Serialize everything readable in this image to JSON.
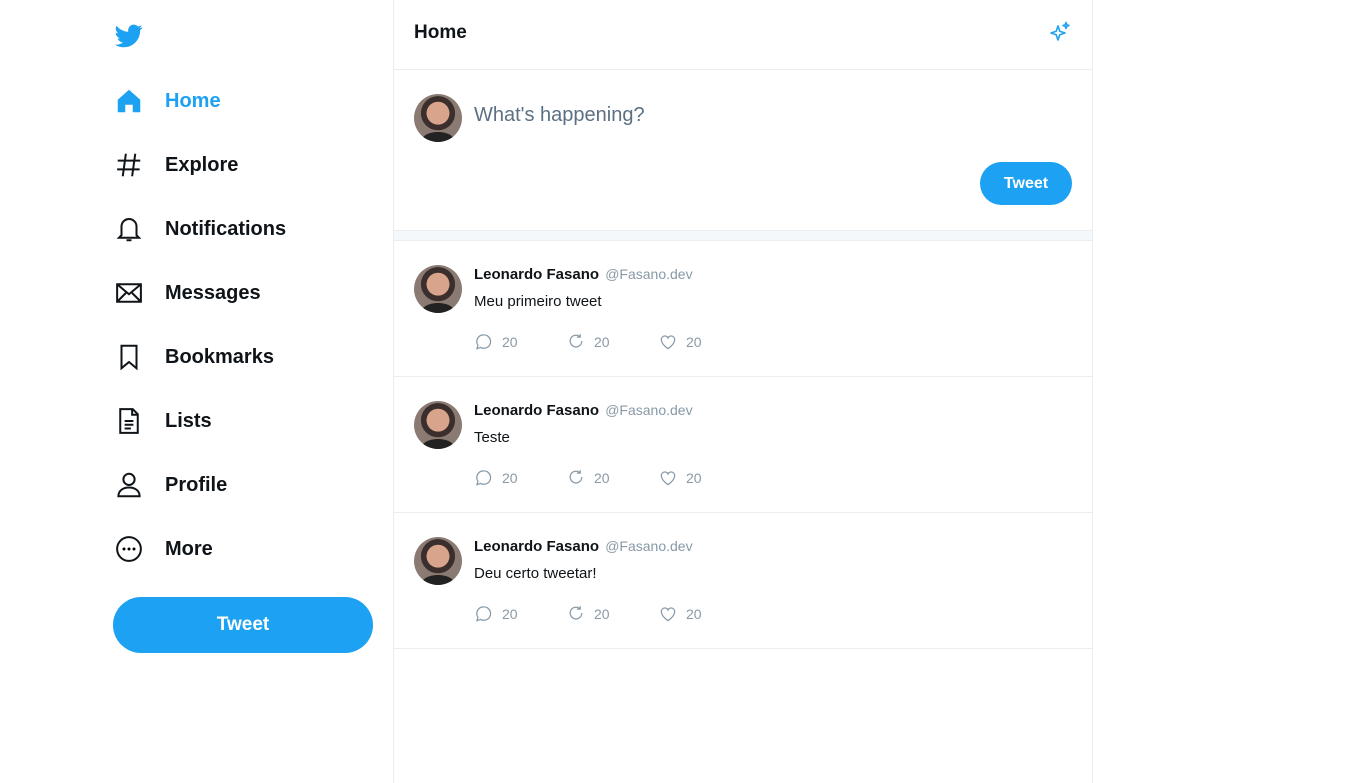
{
  "colors": {
    "accent": "#1da1f2",
    "muted": "#8899a6",
    "border": "#ebeef0"
  },
  "sidebar": {
    "logo": "twitter-bird-icon",
    "items": [
      {
        "label": "Home",
        "icon": "home-icon",
        "active": true
      },
      {
        "label": "Explore",
        "icon": "hashtag-icon"
      },
      {
        "label": "Notifications",
        "icon": "bell-icon"
      },
      {
        "label": "Messages",
        "icon": "envelope-icon"
      },
      {
        "label": "Bookmarks",
        "icon": "bookmark-icon"
      },
      {
        "label": "Lists",
        "icon": "list-icon"
      },
      {
        "label": "Profile",
        "icon": "user-icon"
      },
      {
        "label": "More",
        "icon": "more-icon"
      }
    ],
    "tweet_button": "Tweet"
  },
  "header": {
    "title": "Home",
    "icon": "sparkle-icon"
  },
  "composer": {
    "placeholder": "What's happening?",
    "button": "Tweet"
  },
  "tweets": [
    {
      "name": "Leonardo Fasano",
      "handle": "@Fasano.dev",
      "text": "Meu primeiro tweet",
      "replies": "20",
      "retweets": "20",
      "likes": "20"
    },
    {
      "name": "Leonardo Fasano",
      "handle": "@Fasano.dev",
      "text": "Teste",
      "replies": "20",
      "retweets": "20",
      "likes": "20"
    },
    {
      "name": "Leonardo Fasano",
      "handle": "@Fasano.dev",
      "text": "Deu certo tweetar!",
      "replies": "20",
      "retweets": "20",
      "likes": "20"
    }
  ]
}
